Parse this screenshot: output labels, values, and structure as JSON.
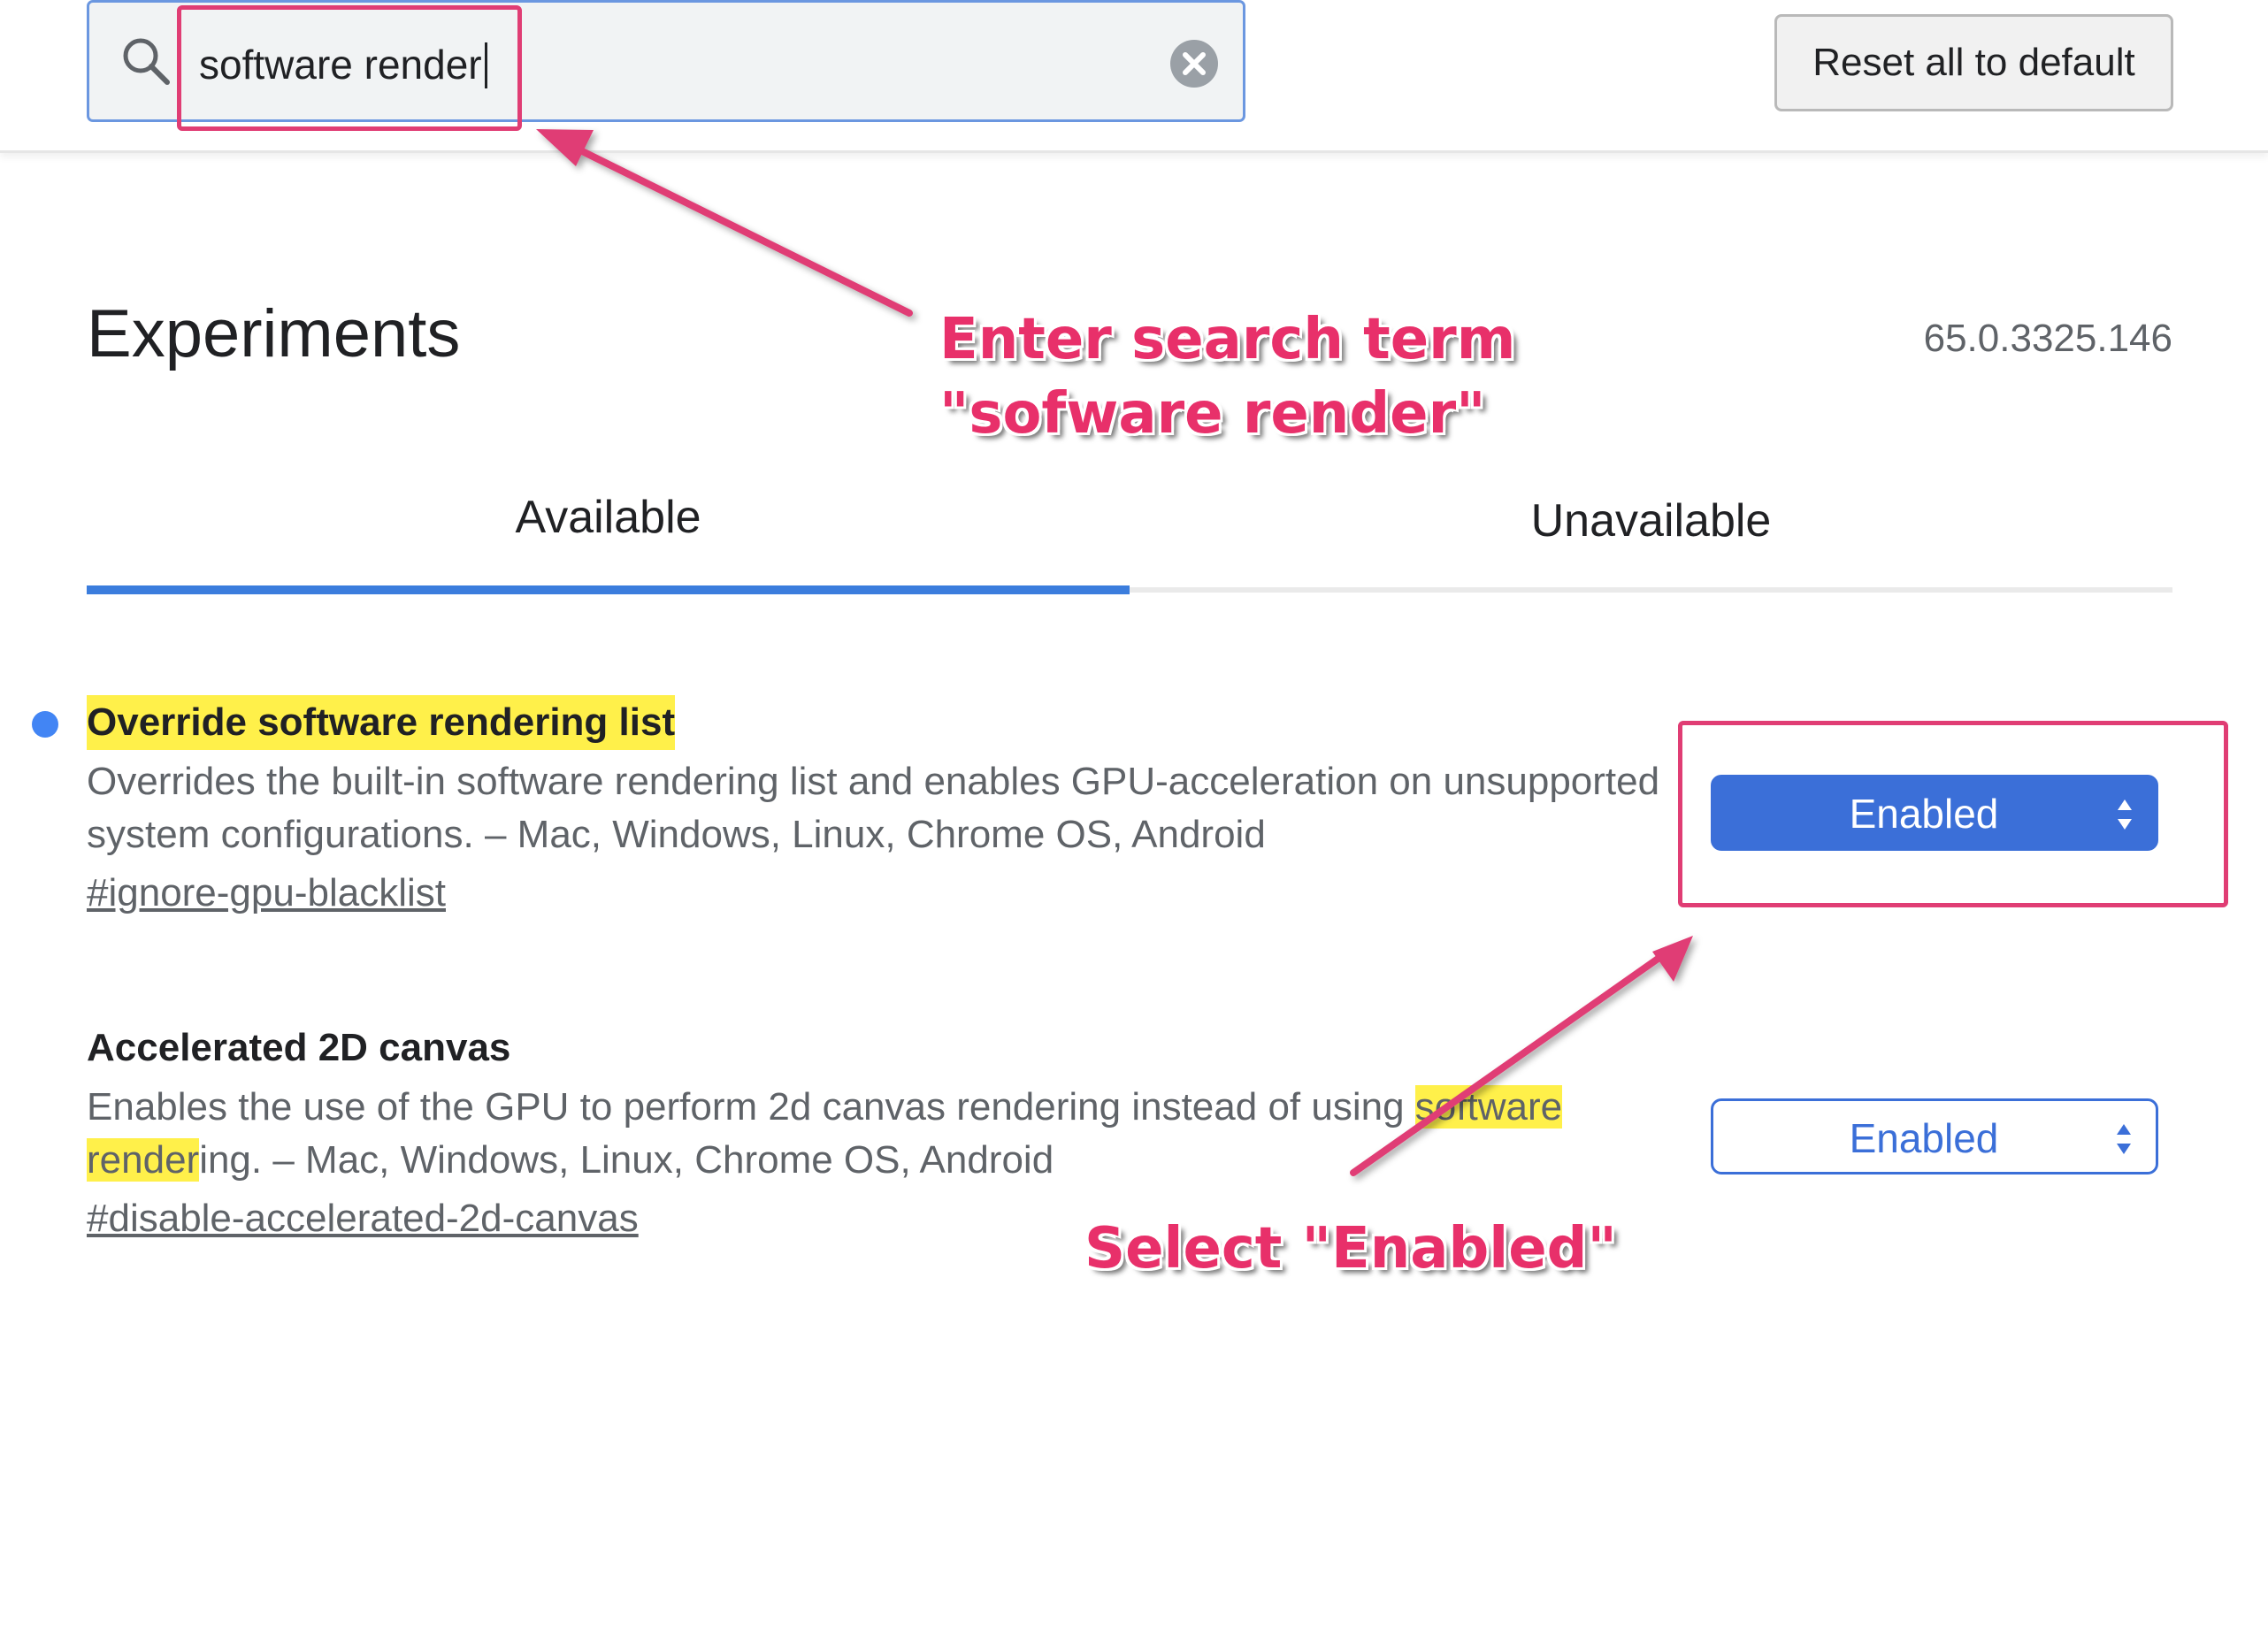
{
  "header": {
    "search": {
      "value": "software render",
      "icon": "search-icon",
      "clear_icon": "close-circle-icon"
    },
    "reset_label": "Reset all to default"
  },
  "page": {
    "title": "Experiments",
    "version": "65.0.3325.146"
  },
  "tabs": [
    {
      "label": "Available",
      "active": true
    },
    {
      "label": "Unavailable",
      "active": false
    }
  ],
  "experiments": [
    {
      "name": "Override software rendering list",
      "description": "Overrides the built-in software rendering list and enables GPU-acceleration on unsupported system configurations. – Mac, Windows, Linux, Chrome OS, Android",
      "link": "#ignore-gpu-blacklist",
      "selected": "Enabled",
      "modified": true
    },
    {
      "name": "Accelerated 2D canvas",
      "description_before": "Enables the use of the GPU to perform 2d canvas rendering instead of using ",
      "description_highlight": "software render",
      "description_after": "ing. – Mac, Windows, Linux, Chrome OS, Android",
      "link": "#disable-accelerated-2d-canvas",
      "selected": "Enabled",
      "modified": false
    }
  ],
  "annotations": {
    "search_line1": "Enter search term",
    "search_line2": "\"sofware render\"",
    "select": "Select \"Enabled\""
  },
  "colors": {
    "accent": "#3b6fd8",
    "highlight": "#fff04a",
    "annotation": "#e8306a",
    "modified_dot": "#4285f4"
  }
}
